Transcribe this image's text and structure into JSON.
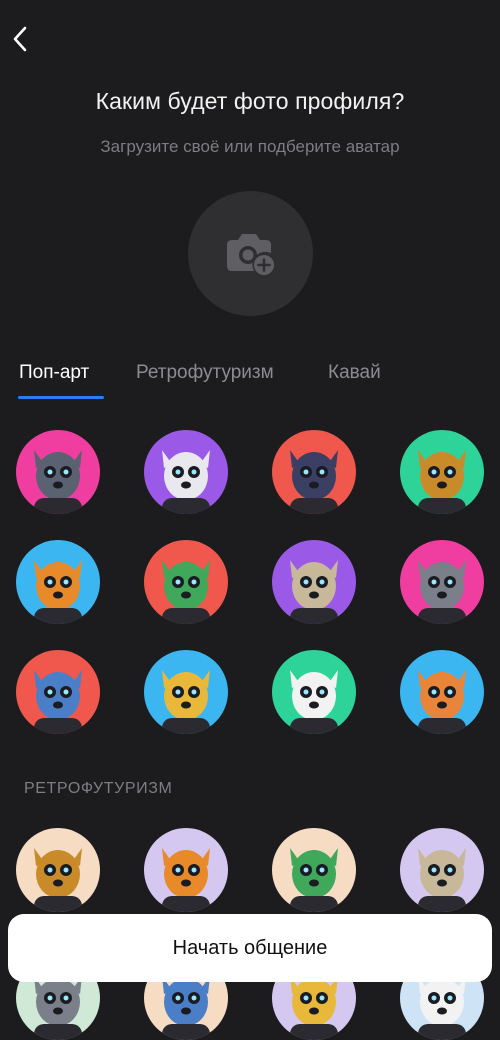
{
  "header": {
    "back_icon": "chevron-left-icon",
    "title": "Каким будет фото профиля?",
    "subtitle": "Загрузите своё или подберите аватар"
  },
  "upload": {
    "icon": "camera-plus-icon"
  },
  "tabs": [
    {
      "label": "Поп-арт",
      "active": true
    },
    {
      "label": "Ретрофутуризм",
      "active": false
    },
    {
      "label": "Кавай",
      "active": false
    }
  ],
  "colors": {
    "background": "#1c1c1e",
    "accent": "#2d7cf6",
    "upload_circle": "#2f2f32",
    "muted_text": "#7d7d82"
  },
  "popart_avatars": [
    {
      "name": "cat",
      "bg": "#f03ea0"
    },
    {
      "name": "rabbit",
      "bg": "#9b59e8"
    },
    {
      "name": "bear",
      "bg": "#f0584e"
    },
    {
      "name": "owl",
      "bg": "#2ed39a"
    },
    {
      "name": "tiger",
      "bg": "#3bb6f0"
    },
    {
      "name": "dragon",
      "bg": "#f0584e"
    },
    {
      "name": "pug",
      "bg": "#9b59e8"
    },
    {
      "name": "raccoon",
      "bg": "#f03ea0"
    },
    {
      "name": "wolf",
      "bg": "#f0584e"
    },
    {
      "name": "giraffe",
      "bg": "#3bb6f0"
    },
    {
      "name": "eagle",
      "bg": "#2ed39a"
    },
    {
      "name": "fox",
      "bg": "#3bb6f0"
    }
  ],
  "retro_section": {
    "label": "РЕТРОФУТУРИЗМ",
    "avatars": [
      {
        "name": "lion",
        "bg": "#f7dcc4"
      },
      {
        "name": "octopus",
        "bg": "#d4c8f0"
      },
      {
        "name": "bear-hat",
        "bg": "#f7dcc4"
      },
      {
        "name": "panther",
        "bg": "#d4c8f0"
      },
      {
        "name": "partial-1",
        "bg": "#cfe9d6"
      },
      {
        "name": "partial-2",
        "bg": "#f7dcc4"
      },
      {
        "name": "partial-3",
        "bg": "#d4c8f0"
      },
      {
        "name": "partial-4",
        "bg": "#cfe3f7"
      }
    ]
  },
  "start_button": {
    "label": "Начать общение"
  }
}
